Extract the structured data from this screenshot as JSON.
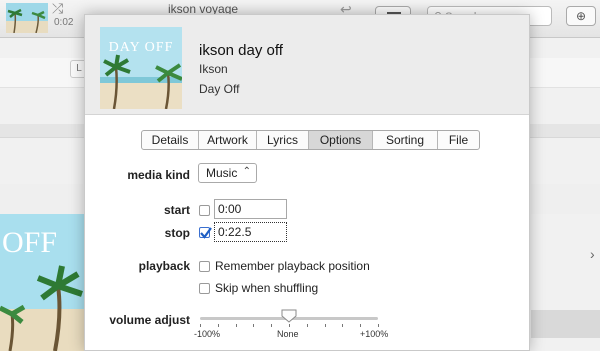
{
  "background": {
    "now_playing": "ikson voyage",
    "elapsed": "0:02",
    "search_placeholder": "Search",
    "side_button": "L",
    "album_art_text": "OFF"
  },
  "dialog": {
    "album_art_text": "DAY OFF",
    "title": "ikson day off",
    "artist": "Ikson",
    "album": "Day Off",
    "tabs": [
      {
        "label": "Details",
        "active": false
      },
      {
        "label": "Artwork",
        "active": false
      },
      {
        "label": "Lyrics",
        "active": false
      },
      {
        "label": "Options",
        "active": true
      },
      {
        "label": "Sorting",
        "active": false
      },
      {
        "label": "File",
        "active": false
      }
    ],
    "options": {
      "media_kind_label": "media kind",
      "media_kind_value": "Music",
      "start_label": "start",
      "start_checked": false,
      "start_value": "0:00",
      "stop_label": "stop",
      "stop_checked": true,
      "stop_value": "0:22.5",
      "playback_label": "playback",
      "remember_label": "Remember playback position",
      "remember_checked": false,
      "skip_label": "Skip when shuffling",
      "skip_checked": false,
      "volume_label": "volume adjust",
      "volume_value": 0.5,
      "volume_min_label": "-100%",
      "volume_mid_label": "None",
      "volume_max_label": "+100%"
    }
  },
  "colors": {
    "accent": "#3a6fd0",
    "active_tab": "#d7d7d7",
    "dialog_header": "#ececec"
  }
}
